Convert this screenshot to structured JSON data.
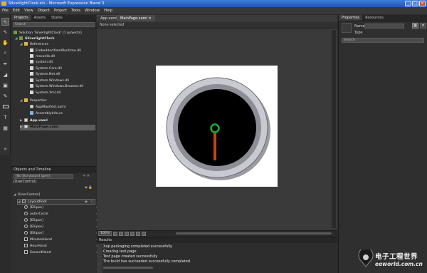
{
  "window": {
    "title": "SilverlightClock.sln - Microsoft Expression Blend 3",
    "buttons": [
      "_",
      "□",
      "×"
    ]
  },
  "menu": [
    "File",
    "Edit",
    "View",
    "Object",
    "Project",
    "Tools",
    "Window",
    "Help"
  ],
  "tools": [
    "selection-arrow",
    "direct-select",
    "pan-hand",
    "zoom",
    "eyedropper",
    "paint-bucket",
    "brush-transform",
    "pen",
    "rectangle",
    "text",
    "layout-grid",
    "asset-library"
  ],
  "projects_panel": {
    "tabs": [
      "Projects",
      "Assets",
      "States"
    ],
    "search_placeholder": "Search",
    "solution": "Solution 'SilverlightClock' (1 projects)",
    "project": "SilverlightClock",
    "references_label": "References",
    "references": [
      "EmbeddedXamlRuntime.dll",
      "mscorlib.dll",
      "system.dll",
      "System.Core.dll",
      "System.Net.dll",
      "System.Windows.dll",
      "System.Windows.Browser.dll",
      "System.Xml.dll"
    ],
    "properties_label": "Properties",
    "properties_files": [
      "AppManifest.xaml",
      "AssemblyInfo.cs"
    ],
    "files": [
      "App.xaml",
      "MainPage.xaml"
    ]
  },
  "objects_panel": {
    "title": "Objects and Timeline",
    "storyboard_placeholder": "(No Storyboard open)",
    "root_label": "[UserControl]",
    "usercontrol": "[UserControl]",
    "layoutroot": "LayoutRoot",
    "children": [
      "[Ellipse]",
      "outerCircle",
      "[Ellipse]",
      "[Ellipse]",
      "[Ellipse]",
      "MinutesHand",
      "HourHand",
      "SecondHand"
    ]
  },
  "document": {
    "tabs": [
      "App.xaml",
      "MainPage.xaml"
    ],
    "selection": "None selected",
    "zoom": "100%"
  },
  "properties_panel": {
    "tabs": [
      "Properties",
      "Resources"
    ],
    "name_label": "Name",
    "type_label": "Type",
    "search_placeholder": "Search"
  },
  "results": {
    "title": "Results",
    "side_tabs": [
      "Errors",
      "Output"
    ],
    "lines": [
      "Xap packaging completed successfully",
      "Creating test page",
      "Test page created successfully",
      "The build has succeeded successfully completed."
    ]
  },
  "watermark": {
    "brand": "电子工程世界",
    "url": "eeworld.com.cn"
  },
  "colors": {
    "clock_face": "#000000",
    "ring_outer": "#c9c9d2",
    "ring_inner": "#8d8d95",
    "center_ring": "#1db32a",
    "hand": "#c0441d",
    "artboard": "#ffffff"
  }
}
